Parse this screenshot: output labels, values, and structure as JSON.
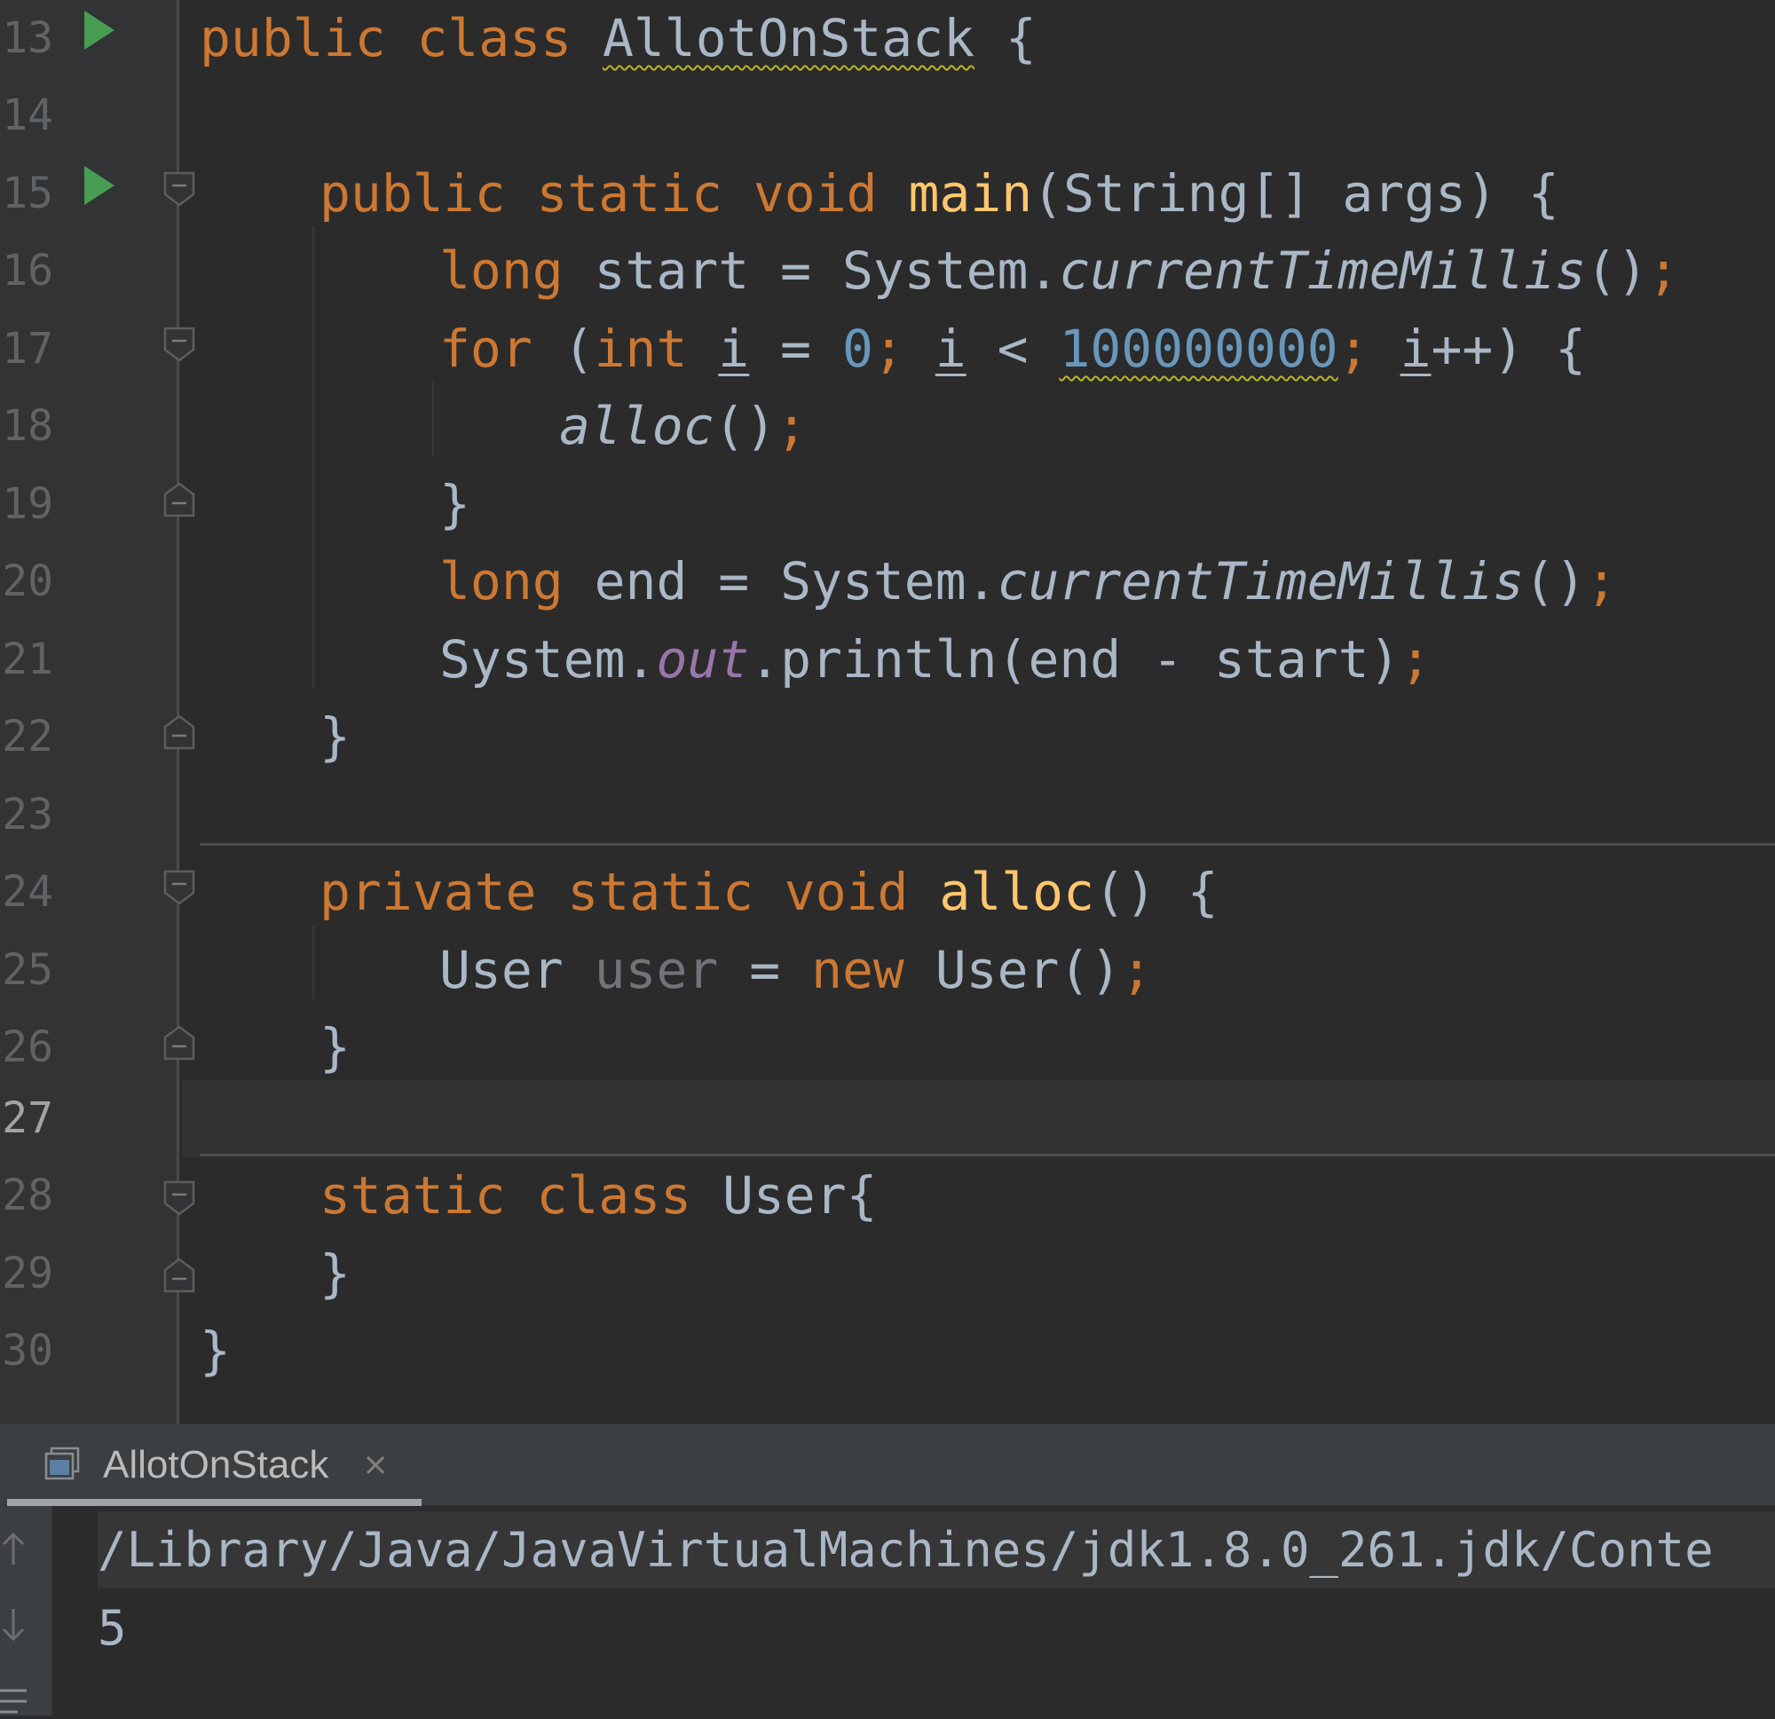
{
  "editor": {
    "line_numbers": [
      "13",
      "14",
      "15",
      "16",
      "17",
      "18",
      "19",
      "20",
      "21",
      "22",
      "23",
      "24",
      "25",
      "26",
      "27",
      "28",
      "29",
      "30"
    ],
    "current_line": "27"
  },
  "code": {
    "l13": [
      "public",
      "class",
      "AllotOnStack",
      "{"
    ],
    "l15": [
      "public",
      "static",
      "void",
      "main",
      "(String[] args) {"
    ],
    "l16": [
      "long",
      " start = System.",
      "currentTimeMillis",
      "()",
      ";"
    ],
    "l17": [
      "for",
      " (",
      "int",
      " ",
      "i",
      " = ",
      "0",
      ";",
      " ",
      "i",
      " < ",
      "100000000",
      ";",
      " ",
      "i",
      "++) {"
    ],
    "l18": [
      "alloc",
      "()",
      ";"
    ],
    "l19": [
      "}"
    ],
    "l20": [
      "long",
      " end = System.",
      "currentTimeMillis",
      "()",
      ";"
    ],
    "l21": [
      "System.",
      "out",
      ".println(end - start)",
      ";"
    ],
    "l22": [
      "}"
    ],
    "l24": [
      "private",
      "static",
      "void",
      "alloc",
      "() {"
    ],
    "l25": [
      "User ",
      "user",
      " = ",
      "new",
      " User()",
      ";"
    ],
    "l26": [
      "}"
    ],
    "l28": [
      "static",
      "class",
      "User{"
    ],
    "l29": [
      "}"
    ],
    "l30": [
      "}"
    ]
  },
  "run_panel": {
    "tab_label": "AllotOnStack",
    "tab_close": "×",
    "console": {
      "command": "/Library/Java/JavaVirtualMachines/jdk1.8.0_261.jdk/Conte",
      "output": "5"
    }
  },
  "icons": {
    "run": "run-gutter-icon",
    "fold": "fold-marker-icon",
    "console_tab": "console-icon",
    "scroll_up": "arrow-up-icon",
    "scroll_down": "arrow-down-icon",
    "soft_wrap": "wrap-icon"
  },
  "colors": {
    "keyword": "#cc7832",
    "function": "#ffc66d",
    "number": "#6897bb",
    "text": "#a9b7c6",
    "static_field": "#9876aa",
    "unused": "#72737a",
    "run_green": "#499c54",
    "background": "#2b2b2b"
  }
}
